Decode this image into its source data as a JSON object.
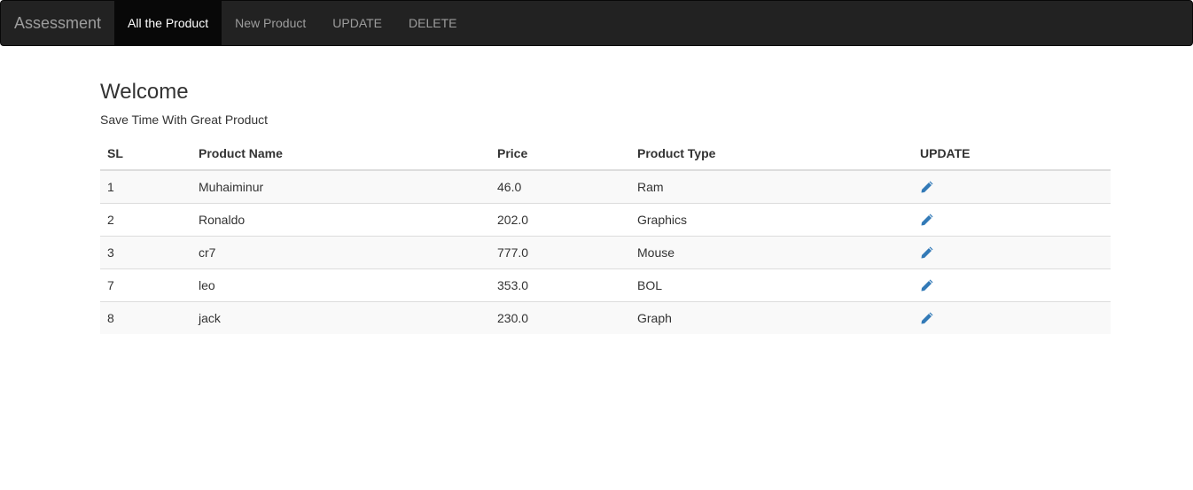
{
  "navbar": {
    "brand": "Assessment",
    "items": [
      {
        "label": "All the Product",
        "active": true
      },
      {
        "label": "New Product",
        "active": false
      },
      {
        "label": "UPDATE",
        "active": false
      },
      {
        "label": "DELETE",
        "active": false
      }
    ]
  },
  "page": {
    "title": "Welcome",
    "subtitle": "Save Time With Great Product"
  },
  "table": {
    "headers": [
      "SL",
      "Product Name",
      "Price",
      "Product Type",
      "UPDATE"
    ],
    "rows": [
      {
        "sl": "1",
        "name": "Muhaiminur",
        "price": "46.0",
        "type": "Ram",
        "action_icon": "pencil-icon"
      },
      {
        "sl": "2",
        "name": "Ronaldo",
        "price": "202.0",
        "type": "Graphics",
        "action_icon": "pencil-icon"
      },
      {
        "sl": "3",
        "name": "cr7",
        "price": "777.0",
        "type": "Mouse",
        "action_icon": "pencil-icon"
      },
      {
        "sl": "7",
        "name": "leo",
        "price": "353.0",
        "type": "BOL",
        "action_icon": "pencil-icon"
      },
      {
        "sl": "8",
        "name": "jack",
        "price": "230.0",
        "type": "Graph",
        "action_icon": "pencil-icon"
      }
    ]
  },
  "colors": {
    "navbar_bg": "#222222",
    "active_bg": "#080808",
    "icon_blue": "#337ab7"
  }
}
